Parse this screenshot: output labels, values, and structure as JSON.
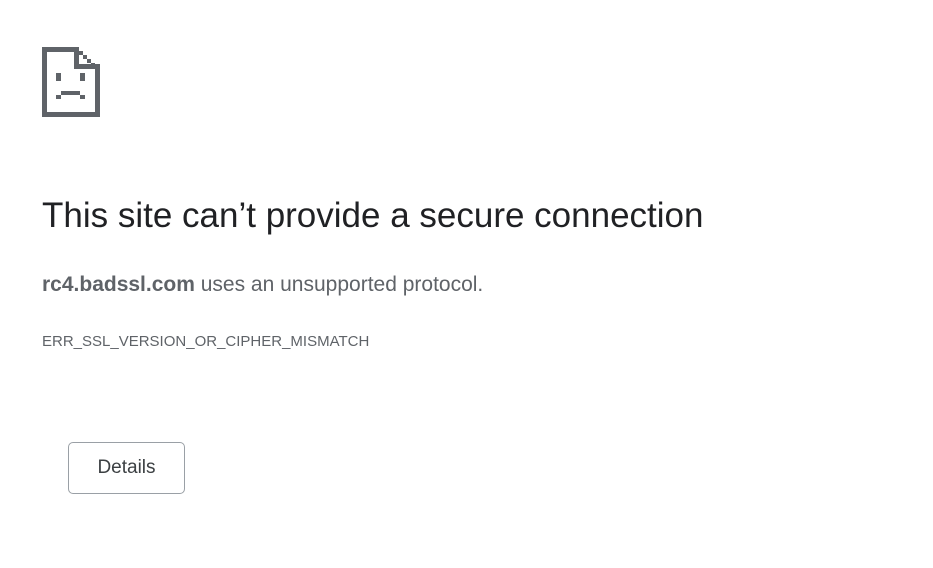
{
  "error_page": {
    "icon": "sad-document-icon",
    "heading": "This site can’t provide a secure connection",
    "host": "rc4.badssl.com",
    "message": " uses an unsupported protocol.",
    "error_code": "ERR_SSL_VERSION_OR_CIPHER_MISMATCH",
    "details_label": "Details"
  },
  "colors": {
    "heading": "#202124",
    "body_text": "#5f6368",
    "icon": "#5f6368",
    "button_border": "#9aa0a6",
    "background": "#ffffff"
  }
}
